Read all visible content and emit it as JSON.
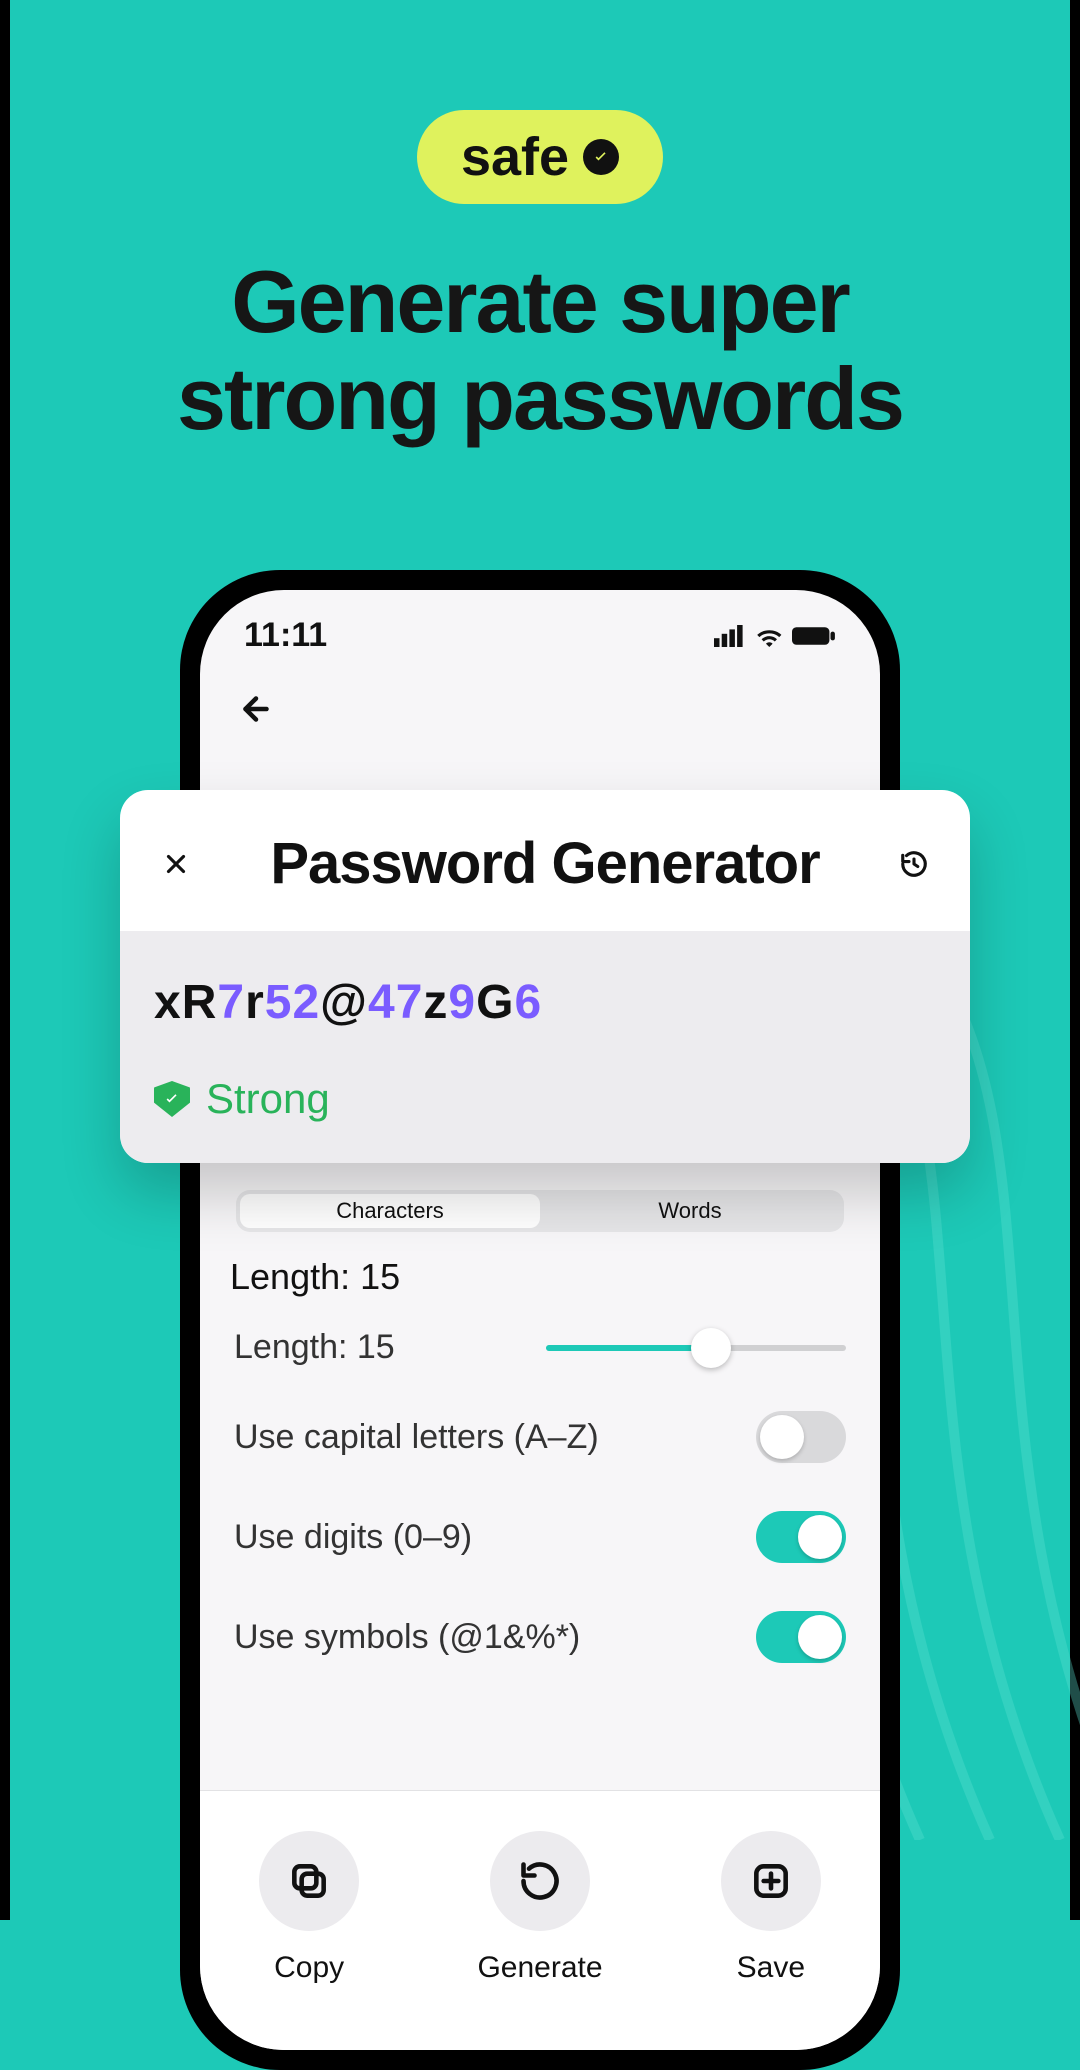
{
  "promo": {
    "badge": "safe",
    "headline_l1": "Generate super",
    "headline_l2": "strong passwords"
  },
  "statusbar": {
    "time": "11:11"
  },
  "card": {
    "title": "Password Generator",
    "password_parts": [
      {
        "t": "x",
        "c": "l"
      },
      {
        "t": "R",
        "c": "l"
      },
      {
        "t": "7",
        "c": "d"
      },
      {
        "t": "r",
        "c": "l"
      },
      {
        "t": "5",
        "c": "d"
      },
      {
        "t": "2",
        "c": "d"
      },
      {
        "t": "@",
        "c": "s"
      },
      {
        "t": "4",
        "c": "d"
      },
      {
        "t": "7",
        "c": "d"
      },
      {
        "t": "z",
        "c": "l"
      },
      {
        "t": "9",
        "c": "d"
      },
      {
        "t": "G",
        "c": "l"
      },
      {
        "t": "6",
        "c": "d"
      }
    ],
    "strength": "Strong"
  },
  "segment": {
    "a": "Characters",
    "b": "Words"
  },
  "length_header": "Length: 15",
  "slider_label": "Length: 15",
  "options": {
    "caps": {
      "label": "Use capital letters (A–Z)",
      "on": false
    },
    "digits": {
      "label": "Use digits (0–9)",
      "on": true
    },
    "symbols": {
      "label": "Use symbols (@1&%*)",
      "on": true
    }
  },
  "actions": {
    "copy": "Copy",
    "generate": "Generate",
    "save": "Save"
  }
}
